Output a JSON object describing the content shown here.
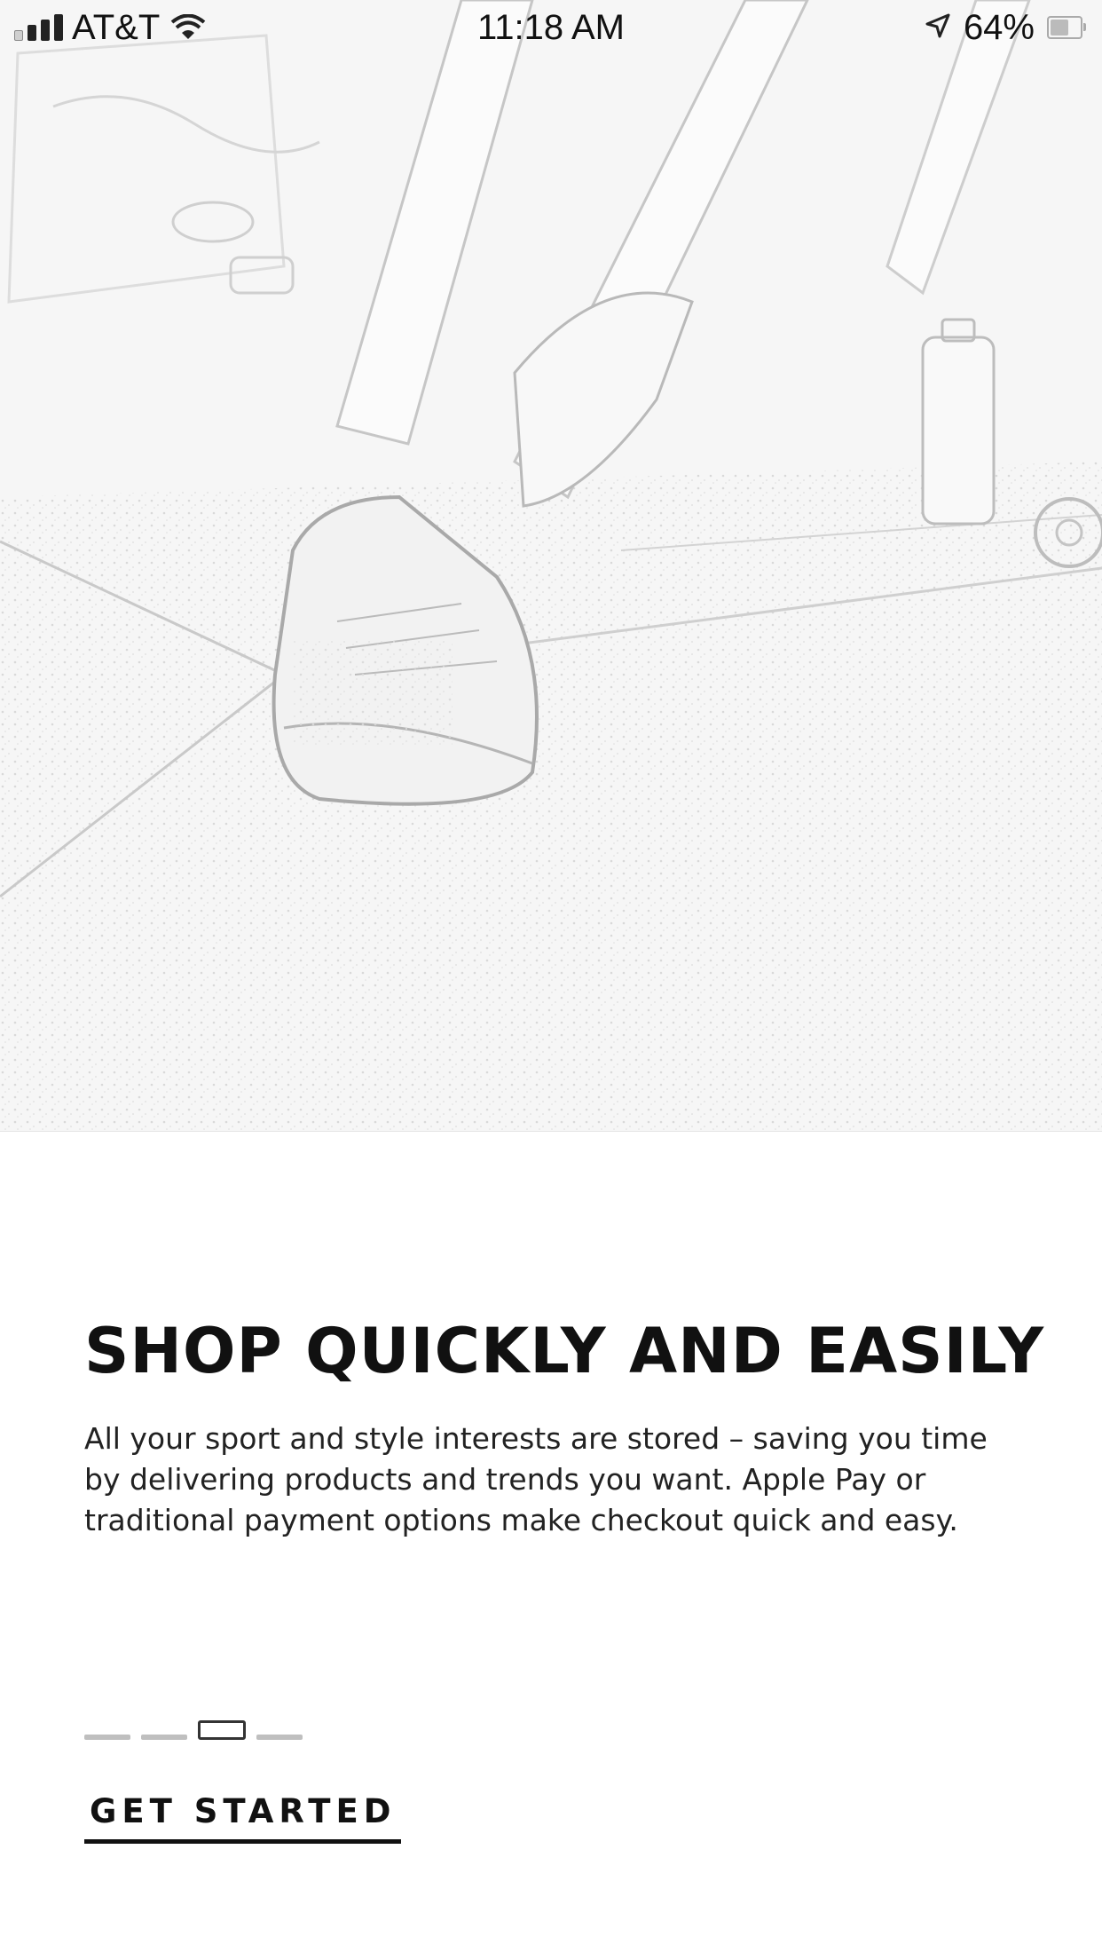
{
  "status_bar": {
    "carrier": "AT&T",
    "time": "11:18 AM",
    "battery": "64%",
    "battery_level": 0.64,
    "icons": [
      "signal-icon",
      "wifi-icon",
      "location-arrow-icon",
      "battery-icon"
    ]
  },
  "hero": {
    "image": "running-shoe-photo"
  },
  "onboarding": {
    "headline": "SHOP QUICKLY AND EASILY",
    "description": "All your sport and style interests are stored – saving you time by delivering products and trends you want. Apple Pay or traditional payment options make checkout quick and easy.",
    "page_count": 4,
    "current_page": 3,
    "cta_label": "GET STARTED"
  }
}
